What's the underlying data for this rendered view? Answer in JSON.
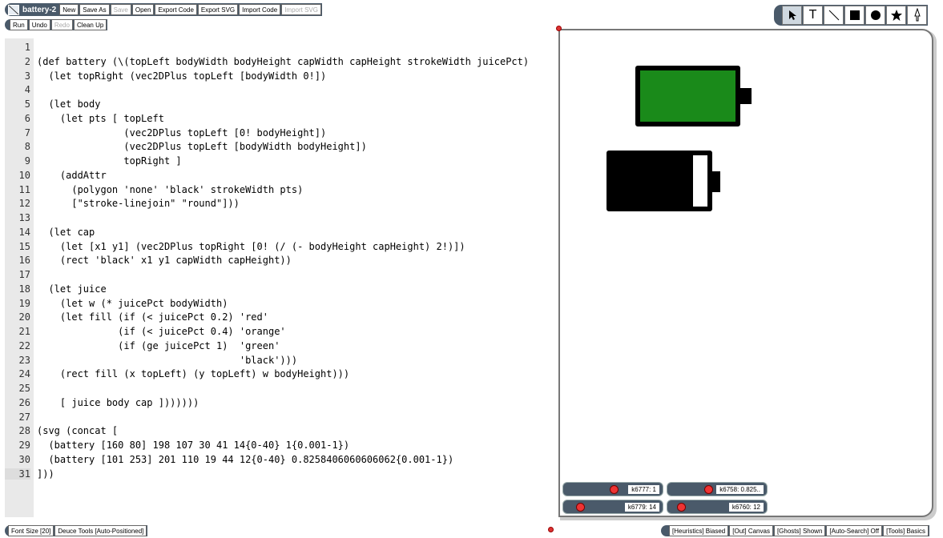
{
  "menu": {
    "title": "battery-2",
    "buttons": [
      "New",
      "Save As",
      "Save",
      "Open",
      "Export Code",
      "Export SVG",
      "Import Code",
      "Import SVG"
    ],
    "disabled": [
      "Save",
      "Import SVG"
    ]
  },
  "editbar": {
    "buttons": [
      "Run",
      "Undo",
      "Redo",
      "Clean Up"
    ],
    "disabled": [
      "Redo"
    ]
  },
  "tools": [
    "cursor",
    "T",
    "line",
    "rect",
    "circle",
    "star",
    "pen"
  ],
  "code_lines": [
    "",
    "(def battery (\\(topLeft bodyWidth bodyHeight capWidth capHeight strokeWidth juicePct)",
    "  (let topRight (vec2DPlus topLeft [bodyWidth 0!])",
    "",
    "  (let body",
    "    (let pts [ topLeft",
    "               (vec2DPlus topLeft [0! bodyHeight])",
    "               (vec2DPlus topLeft [bodyWidth bodyHeight])",
    "               topRight ]",
    "    (addAttr",
    "      (polygon 'none' 'black' strokeWidth pts)",
    "      [\"stroke-linejoin\" \"round\"]))",
    "",
    "  (let cap",
    "    (let [x1 y1] (vec2DPlus topRight [0! (/ (- bodyHeight capHeight) 2!)])",
    "    (rect 'black' x1 y1 capWidth capHeight))",
    "",
    "  (let juice",
    "    (let w (* juicePct bodyWidth)",
    "    (let fill (if (< juicePct 0.2) 'red'",
    "              (if (< juicePct 0.4) 'orange'",
    "              (if (ge juicePct 1)  'green'",
    "                                   'black')))",
    "    (rect fill (x topLeft) (y topLeft) w bodyHeight)))",
    "",
    "    [ juice body cap ])))))) ",
    "",
    "(svg (concat [",
    "  (battery [160 80] 198 107 30 41 14{0-40} 1{0.001-1})",
    "  (battery [101 253] 201 110 19 44 12{0-40} 0.8258406060606062{0.001-1})",
    "]))"
  ],
  "line_numbers": [
    "1",
    "2",
    "3",
    "4",
    "5",
    "6",
    "7",
    "8",
    "9",
    "10",
    "11",
    "12",
    "13",
    "14",
    "15",
    "16",
    "17",
    "18",
    "19",
    "20",
    "21",
    "22",
    "23",
    "24",
    "25",
    "26",
    "27",
    "28",
    "29",
    "30",
    "31"
  ],
  "sliders": [
    {
      "label": "k6777: 1",
      "value": 1.0
    },
    {
      "label": "k6758: 0.825..",
      "value": 0.8258
    },
    {
      "label": "k6779: 14",
      "value": 0.35
    },
    {
      "label": "k6760: 12",
      "value": 0.3
    }
  ],
  "batteries": [
    {
      "juice_color": "#1a8a1a",
      "juice_pct": 1
    },
    {
      "juice_color": "#000000",
      "juice_pct": 0.8258
    }
  ],
  "bottom_left": [
    "Font Size [20]",
    "Deuce Tools [Auto-Positioned]"
  ],
  "bottom_right": [
    "[Heuristics] Biased",
    "[Out] Canvas",
    "[Ghosts] Shown",
    "[Auto-Search] Off",
    "[Tools] Basics"
  ]
}
